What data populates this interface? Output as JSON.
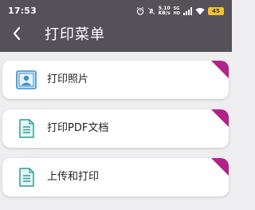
{
  "status_bar": {
    "time": "17:53",
    "net_speed_value": "5.10",
    "net_speed_unit": "KB/s",
    "signal_label_top": "5G",
    "signal_label_bottom": "HD",
    "battery": "45",
    "battery_color": "#f1c232"
  },
  "header": {
    "title": "打印菜单",
    "back_icon": "chevron-left-icon",
    "background": "#545158"
  },
  "menu": {
    "accent_color": "#b0228c",
    "items": [
      {
        "label": "打印照片",
        "icon": "photo-icon"
      },
      {
        "label": "打印PDF文档",
        "icon": "document-icon"
      },
      {
        "label": "上传和打印",
        "icon": "document-icon"
      }
    ]
  }
}
